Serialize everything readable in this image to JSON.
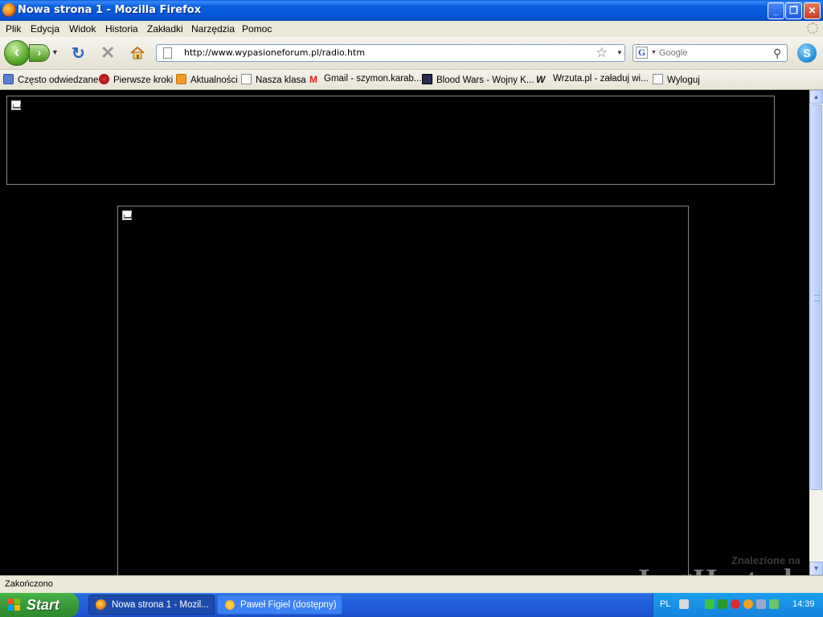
{
  "window": {
    "title": "Nowa strona 1 - Mozilla Firefox",
    "controls": {
      "minimize": "_",
      "maximize": "❐",
      "close": "✕"
    }
  },
  "menu": [
    "Plik",
    "Edycja",
    "Widok",
    "Historia",
    "Zakładki",
    "Narzędzia",
    "Pomoc"
  ],
  "navigation": {
    "url": "http://www.wypasioneforum.pl/radio.htm",
    "search_placeholder": "Google",
    "icons": [
      "back-icon",
      "forward-icon",
      "reload-icon",
      "stop-icon",
      "home-icon",
      "star-icon",
      "magnifier-icon",
      "skype-icon"
    ]
  },
  "bookmarks": [
    {
      "label": "Często odwiedzane",
      "icon": "folder-icon"
    },
    {
      "label": "Pierwsze kroki",
      "icon": "firefox-icon"
    },
    {
      "label": "Aktualności",
      "icon": "rss-icon"
    },
    {
      "label": "Nasza klasa",
      "icon": "page-icon"
    },
    {
      "label": "Gmail - szymon.karab...",
      "icon": "gmail-icon"
    },
    {
      "label": "Blood Wars - Wojny K...",
      "icon": "bloodwars-icon"
    },
    {
      "label": "Wrzuta.pl - załaduj wi...",
      "icon": "wrzuta-icon"
    },
    {
      "label": "Wyloguj",
      "icon": "page-icon"
    }
  ],
  "status": {
    "text": "Zakończono"
  },
  "watermark": {
    "small": "Znalezione na",
    "big": "ImgHost.pl"
  },
  "taskbar": {
    "start_label": "Start",
    "tasks": [
      {
        "label": "Nowa strona 1 - Mozil...",
        "active": true
      },
      {
        "label": "Paweł Figiel (dostępny)",
        "active": false
      }
    ],
    "tray": {
      "language": "PL",
      "clock": "14:39"
    }
  }
}
